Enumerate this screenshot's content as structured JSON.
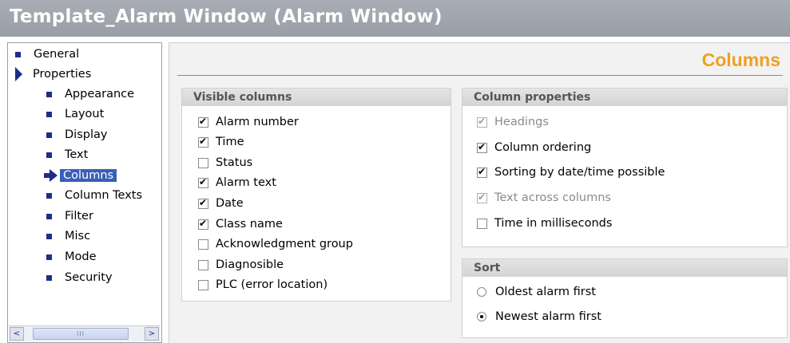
{
  "window": {
    "title": "Template_Alarm Window (Alarm Window)"
  },
  "tree": {
    "items": [
      {
        "label": "General",
        "marker": "bullet-icon",
        "level": 0,
        "selected": false
      },
      {
        "label": "Properties",
        "marker": "expand-arrow-icon",
        "level": 0,
        "selected": false
      },
      {
        "label": "Appearance",
        "marker": "bullet-icon",
        "level": 1,
        "selected": false
      },
      {
        "label": "Layout",
        "marker": "bullet-icon",
        "level": 1,
        "selected": false
      },
      {
        "label": "Display",
        "marker": "bullet-icon",
        "level": 1,
        "selected": false
      },
      {
        "label": "Text",
        "marker": "bullet-icon",
        "level": 1,
        "selected": false
      },
      {
        "label": "Columns",
        "marker": "selected-arrow-icon",
        "level": 1,
        "selected": true
      },
      {
        "label": "Column Texts",
        "marker": "bullet-icon",
        "level": 1,
        "selected": false
      },
      {
        "label": "Filter",
        "marker": "bullet-icon",
        "level": 1,
        "selected": false
      },
      {
        "label": "Misc",
        "marker": "bullet-icon",
        "level": 1,
        "selected": false
      },
      {
        "label": "Mode",
        "marker": "bullet-icon",
        "level": 1,
        "selected": false
      },
      {
        "label": "Security",
        "marker": "bullet-icon",
        "level": 1,
        "selected": false
      }
    ],
    "scrollbar": {
      "left_icon": "<",
      "right_icon": ">",
      "thumb_grip": "III"
    }
  },
  "main": {
    "section_title": "Columns",
    "accent_color": "#f0a020",
    "visible_columns": {
      "header": "Visible columns",
      "items": [
        {
          "label": "Alarm number",
          "checked": true
        },
        {
          "label": "Time",
          "checked": true
        },
        {
          "label": "Status",
          "checked": false
        },
        {
          "label": "Alarm text",
          "checked": true
        },
        {
          "label": "Date",
          "checked": true
        },
        {
          "label": "Class name",
          "checked": true
        },
        {
          "label": "Acknowledgment group",
          "checked": false
        },
        {
          "label": "Diagnosible",
          "checked": false
        },
        {
          "label": "PLC (error location)",
          "checked": false
        }
      ]
    },
    "column_properties": {
      "header": "Column properties",
      "items": [
        {
          "label": "Headings",
          "checked": true,
          "enabled": false
        },
        {
          "label": "Column ordering",
          "checked": true,
          "enabled": true
        },
        {
          "label": "Sorting by date/time possible",
          "checked": true,
          "enabled": true
        },
        {
          "label": "Text across columns",
          "checked": true,
          "enabled": false
        },
        {
          "label": "Time in milliseconds",
          "checked": false,
          "enabled": true
        }
      ]
    },
    "sort": {
      "header": "Sort",
      "options": [
        {
          "label": "Oldest alarm first",
          "selected": false
        },
        {
          "label": "Newest alarm first",
          "selected": true
        }
      ]
    }
  }
}
